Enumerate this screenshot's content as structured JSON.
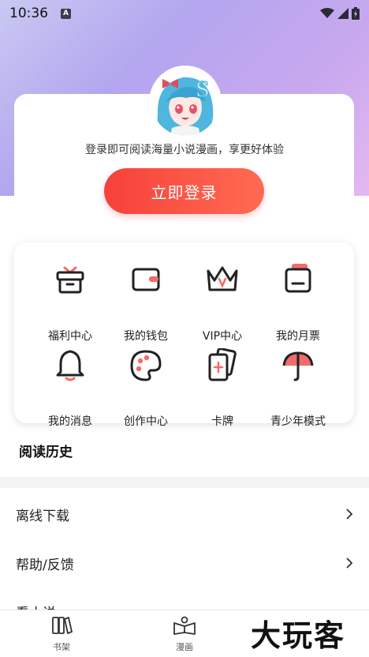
{
  "status_bar": {
    "time": "10:36",
    "input_badge": "A"
  },
  "login": {
    "prompt": "登录即可阅读海量小说漫画，享更好体验",
    "button_label": "立即登录"
  },
  "features": [
    {
      "label": "福利中心",
      "icon": "gift-icon"
    },
    {
      "label": "我的钱包",
      "icon": "wallet-icon"
    },
    {
      "label": "VIP中心",
      "icon": "crown-icon"
    },
    {
      "label": "我的月票",
      "icon": "ticket-icon"
    },
    {
      "label": "我的消息",
      "icon": "bell-icon"
    },
    {
      "label": "创作中心",
      "icon": "palette-icon"
    },
    {
      "label": "卡牌",
      "icon": "cards-icon"
    },
    {
      "label": "青少年模式",
      "icon": "umbrella-icon"
    }
  ],
  "reading_history": {
    "title": "阅读历史"
  },
  "menu": [
    {
      "label": "离线下载"
    },
    {
      "label": "帮助/反馈"
    },
    {
      "label": "看小说"
    }
  ],
  "tabbar": [
    {
      "label": "书架",
      "icon": "bookshelf-icon"
    },
    {
      "label": "漫画",
      "icon": "open-book-icon"
    }
  ],
  "watermark": "大玩客",
  "colors": {
    "accent": "#f7413a",
    "icon_pink": "#f36b6b",
    "icon_dark": "#222222"
  }
}
